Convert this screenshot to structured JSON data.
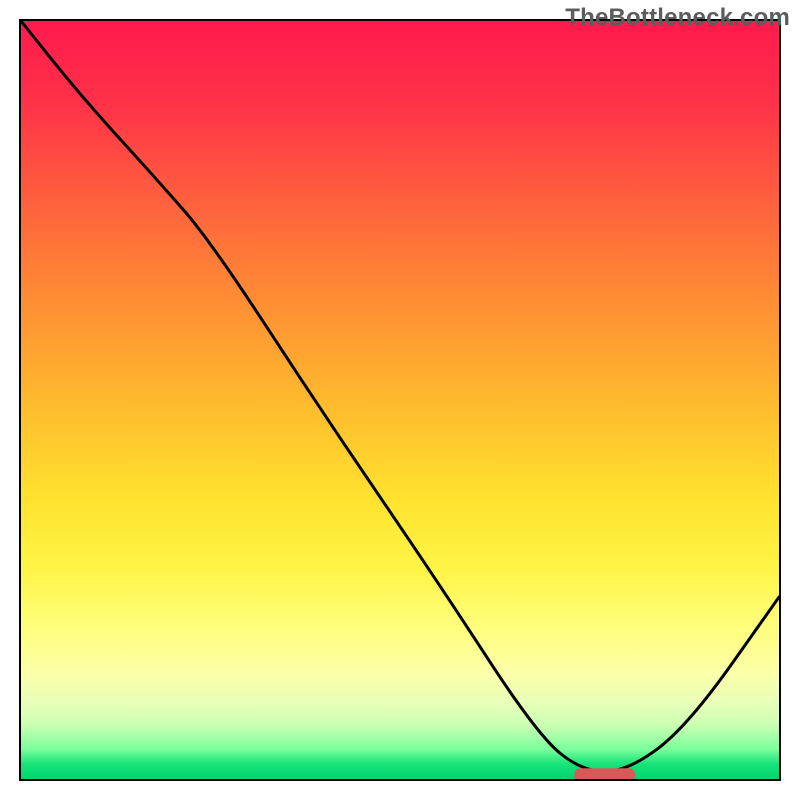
{
  "watermark": "TheBottleneck.com",
  "chart_data": {
    "type": "line",
    "title": "",
    "xlabel": "",
    "ylabel": "",
    "xlim": [
      0,
      100
    ],
    "ylim": [
      0,
      100
    ],
    "series": [
      {
        "name": "bottleneck-curve",
        "x": [
          0,
          8,
          18,
          25,
          40,
          55,
          68,
          74,
          80,
          88,
          100
        ],
        "y": [
          100,
          90,
          79,
          71,
          48,
          26,
          6,
          1,
          1,
          7,
          24
        ]
      }
    ],
    "marker": {
      "name": "optimal-range",
      "x_start": 73,
      "x_end": 81,
      "y": 0.5,
      "color": "#d65a5a"
    },
    "gradient_stops": [
      {
        "pos": 0.0,
        "color": "#ff1a4d"
      },
      {
        "pos": 0.5,
        "color": "#ffe22e"
      },
      {
        "pos": 0.86,
        "color": "#fbffa8"
      },
      {
        "pos": 1.0,
        "color": "#00d56e"
      }
    ]
  }
}
